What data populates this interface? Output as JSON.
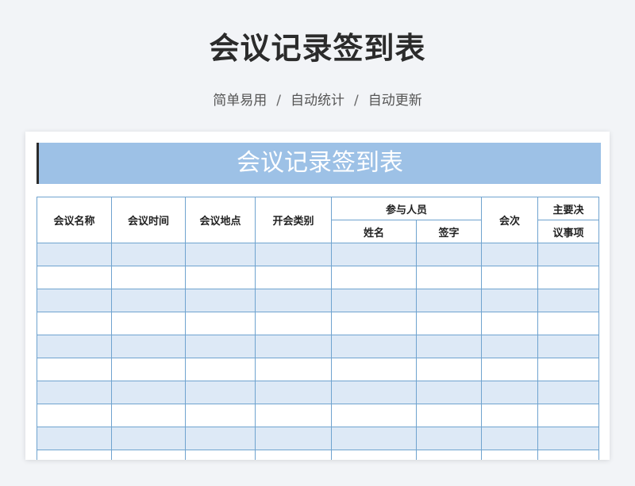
{
  "title": "会议记录签到表",
  "subtitle": {
    "items": [
      "简单易用",
      "自动统计",
      "自动更新"
    ],
    "separator": "/"
  },
  "sheet": {
    "banner": "会议记录签到表",
    "headers": {
      "meeting_name": "会议名称",
      "meeting_time": "会议时间",
      "meeting_place": "会议地点",
      "meeting_type": "开会类别",
      "participants": "参与人员",
      "name": "姓名",
      "signature": "签字",
      "session": "会次",
      "decision_line1": "主要决",
      "decision_line2": "议事项"
    },
    "empty_rows": 10,
    "colors": {
      "banner": "#9dc1e6",
      "shaded_row": "#dde9f6",
      "border": "#6fa3cf"
    }
  }
}
